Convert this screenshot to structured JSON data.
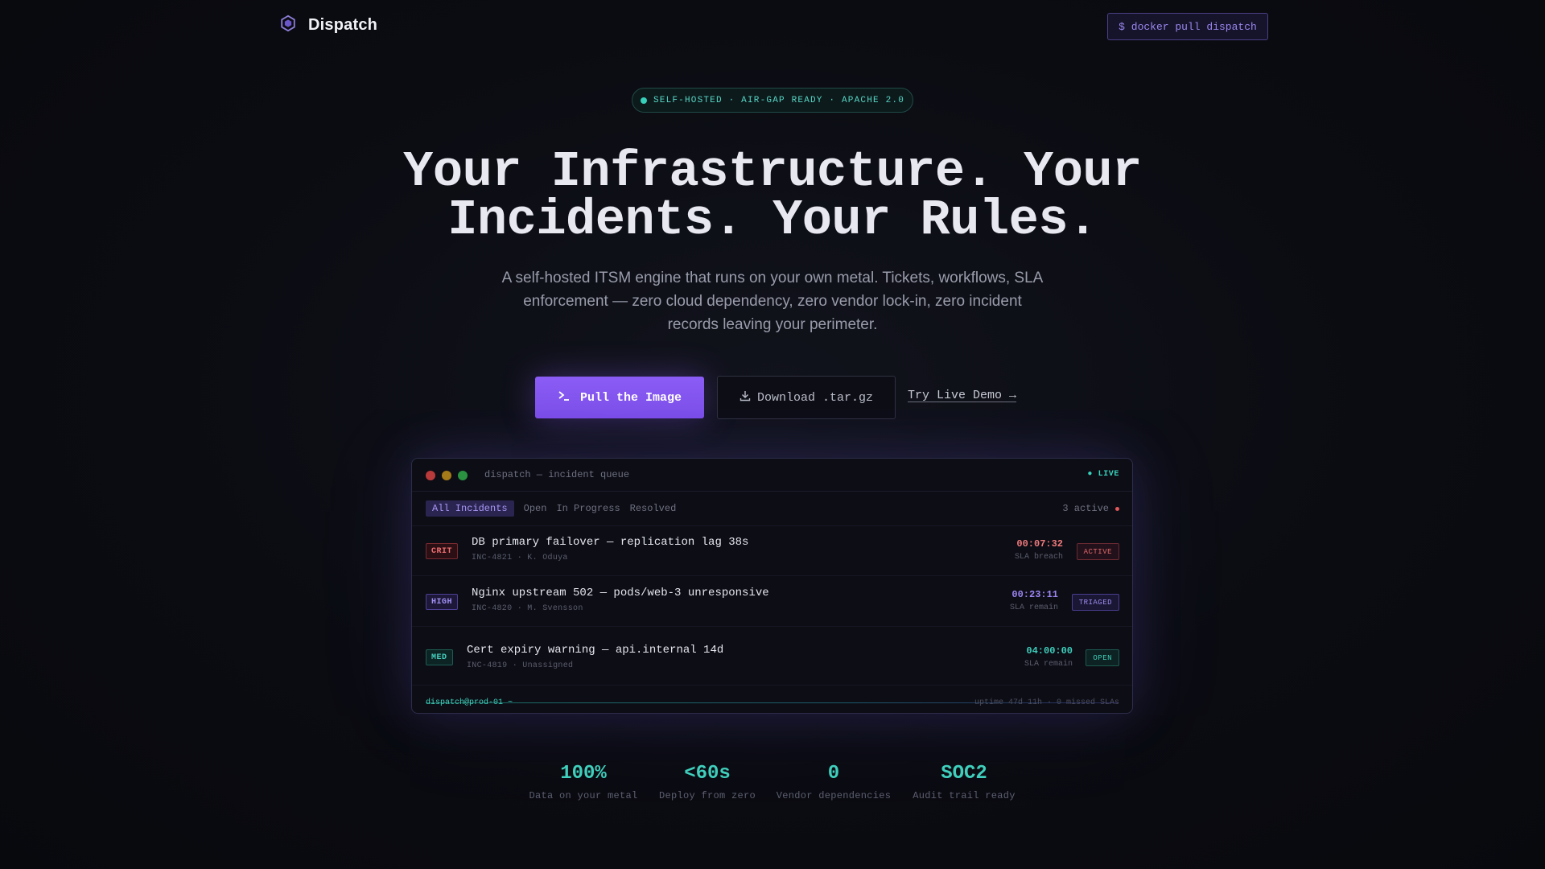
{
  "brand": {
    "name": "Dispatch",
    "icon": "shield-hex-icon"
  },
  "nav": {
    "command_label": "$ docker pull dispatch"
  },
  "badge": {
    "text": "SELF-HOSTED · AIR-GAP READY · APACHE 2.0"
  },
  "hero": {
    "title_line1": "Your Infrastructure. Your",
    "title_line2": "Incidents. Your Rules.",
    "subtitle": "A self-hosted ITSM engine that runs on your own metal. Tickets, workflows, SLA enforcement — zero cloud dependency, zero vendor lock-in, zero incident records leaving your perimeter."
  },
  "cta": {
    "primary_label": "Pull the Image",
    "secondary_label": "Download .tar.gz",
    "link_label": "Try Live Demo →"
  },
  "panel": {
    "title": "dispatch — incident queue",
    "live_label": "● LIVE",
    "filters": [
      "All Incidents",
      "Open",
      "In Progress",
      "Resolved"
    ],
    "active_count": "3 active",
    "incidents": [
      {
        "severity": "CRIT",
        "title": "DB primary failover — replication lag 38s",
        "meta": "INC-4821 · K. Oduya",
        "sla_time": "00:07:32",
        "sla_label": "SLA breach",
        "status": "ACTIVE"
      },
      {
        "severity": "HIGH",
        "title": "Nginx upstream 502 — pods/web-3 unresponsive",
        "meta": "INC-4820 · M. Svensson",
        "sla_time": "00:23:11",
        "sla_label": "SLA remain",
        "status": "TRIAGED"
      },
      {
        "severity": "MED",
        "title": "Cert expiry warning — api.internal 14d",
        "meta": "INC-4819 · Unassigned",
        "sla_time": "04:00:00",
        "sla_label": "SLA remain",
        "status": "OPEN"
      }
    ],
    "footer_prompt": "dispatch@prod-01 ~",
    "footer_status": "uptime 47d 11h · 0 missed SLAs"
  },
  "stats": [
    {
      "value": "100%",
      "label": "Data on your metal"
    },
    {
      "value": "<60s",
      "label": "Deploy from zero"
    },
    {
      "value": "0",
      "label": "Vendor dependencies"
    },
    {
      "value": "SOC2",
      "label": "Audit trail ready"
    }
  ],
  "colors": {
    "accent": "#8b5cf6",
    "teal": "#3fcfbc",
    "critical": "#f06f72",
    "background": "#0b0c12"
  }
}
